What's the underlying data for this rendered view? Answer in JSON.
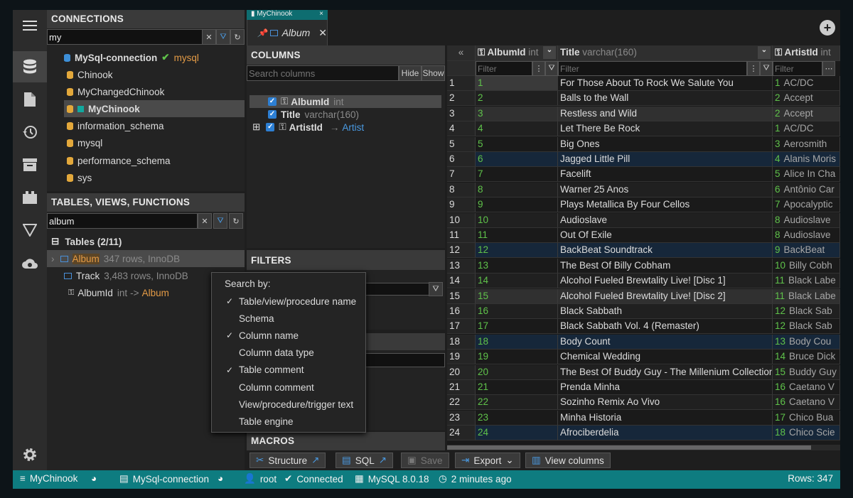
{
  "connections": {
    "title": "CONNECTIONS",
    "filter_value": "my",
    "root": {
      "label": "MySql-connection",
      "driver": "mysql"
    },
    "databases": [
      "Chinook",
      "MyChangedChinook",
      "MyChinook",
      "information_schema",
      "mysql",
      "performance_schema",
      "sys"
    ],
    "selected_index": 2
  },
  "tables_panel": {
    "title": "TABLES, VIEWS, FUNCTIONS",
    "filter_value": "album",
    "group_label": "Tables (2/11)",
    "tables": [
      {
        "name": "Album",
        "info": "347 rows, InnoDB"
      },
      {
        "name": "Track",
        "info": "3,483 rows, InnoDB"
      }
    ],
    "fk": {
      "name": "AlbumId",
      "type": "int",
      "arrow": "->",
      "target": "Album"
    }
  },
  "tabs": {
    "mini_tab": "MyChinook",
    "main_tab": "Album"
  },
  "columns_panel": {
    "title": "COLUMNS",
    "search_placeholder": "Search columns",
    "hide_label": "Hide",
    "show_label": "Show",
    "columns": [
      {
        "name": "AlbumId",
        "type": "int"
      },
      {
        "name": "Title",
        "type": "varchar(160)"
      },
      {
        "name": "ArtistId",
        "type": "",
        "link": "Artist"
      }
    ]
  },
  "filters_title": "FILTERS",
  "macros_title": "MACROS",
  "search_menu": {
    "title": "Search by:",
    "items": [
      {
        "label": "Table/view/procedure name",
        "checked": true
      },
      {
        "label": "Schema",
        "checked": false
      },
      {
        "label": "Column name",
        "checked": true
      },
      {
        "label": "Column data type",
        "checked": false
      },
      {
        "label": "Table comment",
        "checked": true
      },
      {
        "label": "Column comment",
        "checked": false
      },
      {
        "label": "View/procedure/trigger text",
        "checked": false
      },
      {
        "label": "Table engine",
        "checked": false
      }
    ]
  },
  "grid": {
    "collapse_symbol": "«",
    "headers": [
      {
        "name": "AlbumId",
        "type": "int"
      },
      {
        "name": "Title",
        "type": "varchar(160)"
      },
      {
        "name": "ArtistId",
        "type": "int"
      }
    ],
    "filter_placeholder": "Filter",
    "rows": [
      {
        "id": "1",
        "title": "For Those About To Rock We Salute You",
        "aid": "1",
        "artist": "AC/DC"
      },
      {
        "id": "2",
        "title": "Balls to the Wall",
        "aid": "2",
        "artist": "Accept"
      },
      {
        "id": "3",
        "title": "Restless and Wild",
        "aid": "2",
        "artist": "Accept"
      },
      {
        "id": "4",
        "title": "Let There Be Rock",
        "aid": "1",
        "artist": "AC/DC"
      },
      {
        "id": "5",
        "title": "Big Ones",
        "aid": "3",
        "artist": "Aerosmith"
      },
      {
        "id": "6",
        "title": "Jagged Little Pill",
        "aid": "4",
        "artist": "Alanis Moris"
      },
      {
        "id": "7",
        "title": "Facelift",
        "aid": "5",
        "artist": "Alice In Cha"
      },
      {
        "id": "8",
        "title": "Warner 25 Anos",
        "aid": "6",
        "artist": "Antônio Car"
      },
      {
        "id": "9",
        "title": "Plays Metallica By Four Cellos",
        "aid": "7",
        "artist": "Apocalyptic"
      },
      {
        "id": "10",
        "title": "Audioslave",
        "aid": "8",
        "artist": "Audioslave"
      },
      {
        "id": "11",
        "title": "Out Of Exile",
        "aid": "8",
        "artist": "Audioslave"
      },
      {
        "id": "12",
        "title": "BackBeat Soundtrack",
        "aid": "9",
        "artist": "BackBeat"
      },
      {
        "id": "13",
        "title": "The Best Of Billy Cobham",
        "aid": "10",
        "artist": "Billy Cobh"
      },
      {
        "id": "14",
        "title": "Alcohol Fueled Brewtality Live! [Disc 1]",
        "aid": "11",
        "artist": "Black Labe"
      },
      {
        "id": "15",
        "title": "Alcohol Fueled Brewtality Live! [Disc 2]",
        "aid": "11",
        "artist": "Black Labe"
      },
      {
        "id": "16",
        "title": "Black Sabbath",
        "aid": "12",
        "artist": "Black Sab"
      },
      {
        "id": "17",
        "title": "Black Sabbath Vol. 4 (Remaster)",
        "aid": "12",
        "artist": "Black Sab"
      },
      {
        "id": "18",
        "title": "Body Count",
        "aid": "13",
        "artist": "Body Cou"
      },
      {
        "id": "19",
        "title": "Chemical Wedding",
        "aid": "14",
        "artist": "Bruce Dick"
      },
      {
        "id": "20",
        "title": "The Best Of Buddy Guy - The Millenium Collection",
        "aid": "15",
        "artist": "Buddy Guy"
      },
      {
        "id": "21",
        "title": "Prenda Minha",
        "aid": "16",
        "artist": "Caetano V"
      },
      {
        "id": "22",
        "title": "Sozinho Remix Ao Vivo",
        "aid": "16",
        "artist": "Caetano V"
      },
      {
        "id": "23",
        "title": "Minha Historia",
        "aid": "17",
        "artist": "Chico Bua"
      },
      {
        "id": "24",
        "title": "Afrociberdelia",
        "aid": "18",
        "artist": "Chico Scie"
      }
    ]
  },
  "toolbar": {
    "structure": "Structure",
    "sql": "SQL",
    "save": "Save",
    "export": "Export",
    "view_columns": "View columns"
  },
  "status": {
    "database": "MyChinook",
    "connection": "MySql-connection",
    "user": "root",
    "state": "Connected",
    "server": "MySQL 8.0.18",
    "time": "2 minutes ago",
    "rows": "Rows: 347"
  }
}
